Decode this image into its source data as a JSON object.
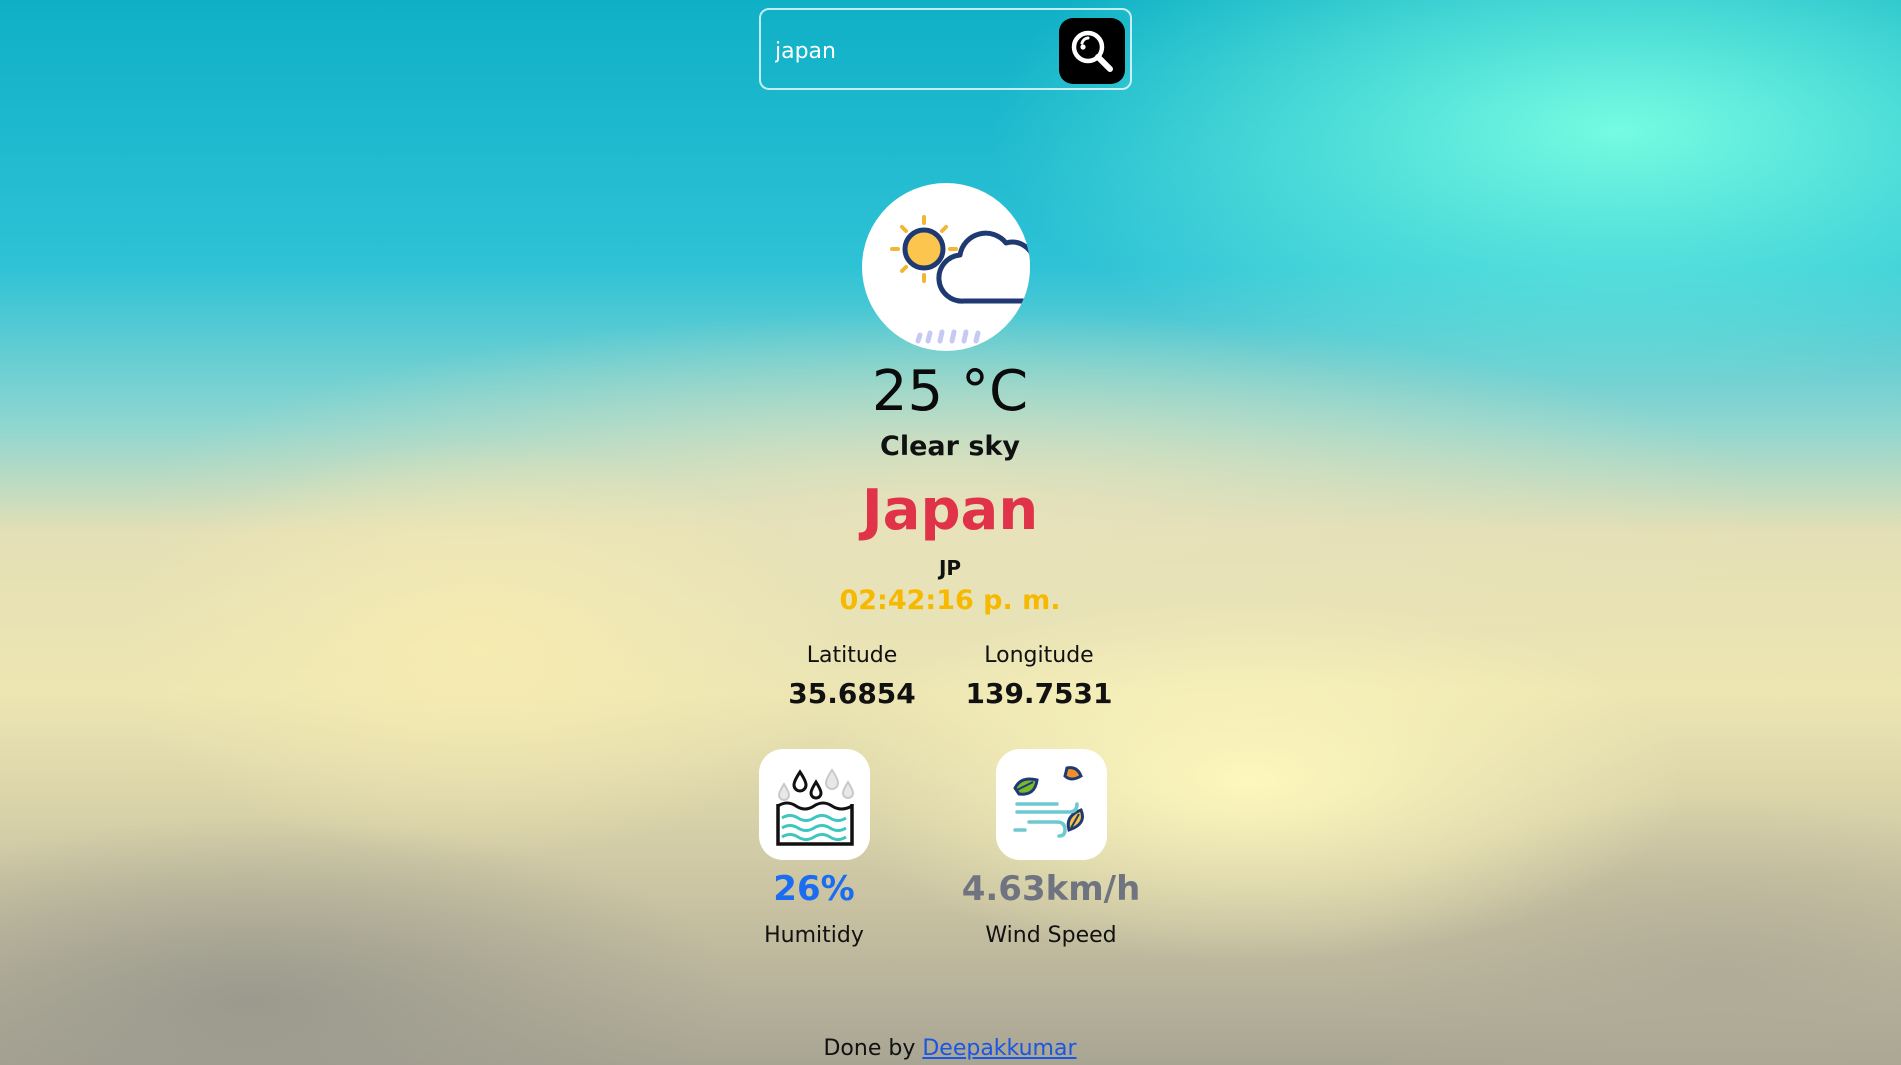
{
  "search": {
    "value": "japan",
    "button_icon": "search-icon"
  },
  "weather": {
    "icon": "sun-cloud-rain-icon",
    "temperature": "25 °C",
    "description": "Clear sky",
    "city": "Japan",
    "country_code": "JP",
    "local_time": "02:42:16 p. m."
  },
  "coordinates": {
    "latitude_label": "Latitude",
    "latitude_value": "35.6854",
    "longitude_label": "Longitude",
    "longitude_value": "139.7531"
  },
  "stats": {
    "humidity": {
      "icon": "humidity-water-icon",
      "value": "26%",
      "label": "Humitidy"
    },
    "wind": {
      "icon": "wind-leaves-icon",
      "value": "4.63km/h",
      "label": "Wind Speed"
    }
  },
  "footer": {
    "prefix": "Done by",
    "author": "Deepakkumar"
  },
  "colors": {
    "city": "#e0334a",
    "time": "#f7b900",
    "humidity": "#1a6cf0",
    "wind": "#6f7480",
    "link": "#1a55e3"
  }
}
